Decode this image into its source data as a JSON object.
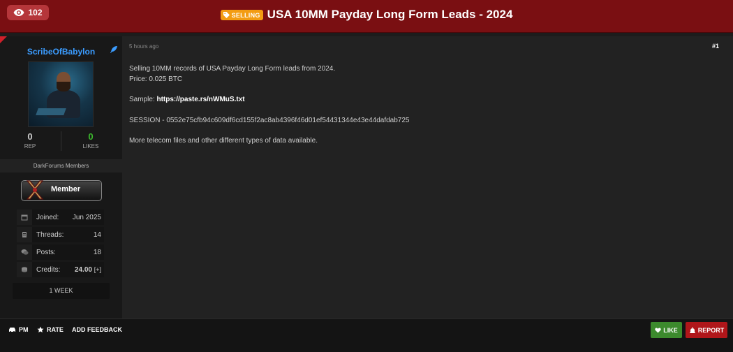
{
  "header": {
    "views": "102",
    "tag_label": "SELLING",
    "title": "USA 10MM Payday Long Form Leads - 2024"
  },
  "sidebar": {
    "username": "ScribeOfBabylon",
    "rep_value": "0",
    "rep_label": "REP",
    "likes_value": "0",
    "likes_label": "LIKES",
    "group": "DarkForums Members",
    "badge": "Member",
    "info": [
      {
        "label": "Joined:",
        "value": "Jun 2025",
        "icon": "calendar-icon"
      },
      {
        "label": "Threads:",
        "value": "14",
        "icon": "threads-icon"
      },
      {
        "label": "Posts:",
        "value": "18",
        "icon": "posts-icon"
      },
      {
        "label": "Credits:",
        "value": "24.00",
        "extra": "[+]",
        "icon": "credits-icon"
      }
    ],
    "week": "1 WEEK"
  },
  "post": {
    "time": "5 hours ago",
    "number": "#1",
    "line1": "Selling 10MM records of USA Payday Long Form leads from 2024.",
    "line2": "Price: 0.025 BTC",
    "sample_label": "Sample:",
    "sample_link": "https://paste.rs/nWMuS.txt",
    "session": "SESSION - 0552e75cfb94c609df6cd155f2ac8ab4396f46d01ef54431344e43e44dafdab725",
    "more": "More telecom files and other different types of data available."
  },
  "footer": {
    "pm": "PM",
    "rate": "RATE",
    "feedback": "ADD FEEDBACK",
    "like": "LIKE",
    "report": "REPORT"
  },
  "colors": {
    "header_bg": "#7a0f12",
    "username": "#3b9cff",
    "tag": "#f39c12",
    "likes": "#3cba2d",
    "like_button": "#3c8a2d",
    "report_button": "#b0161a"
  }
}
